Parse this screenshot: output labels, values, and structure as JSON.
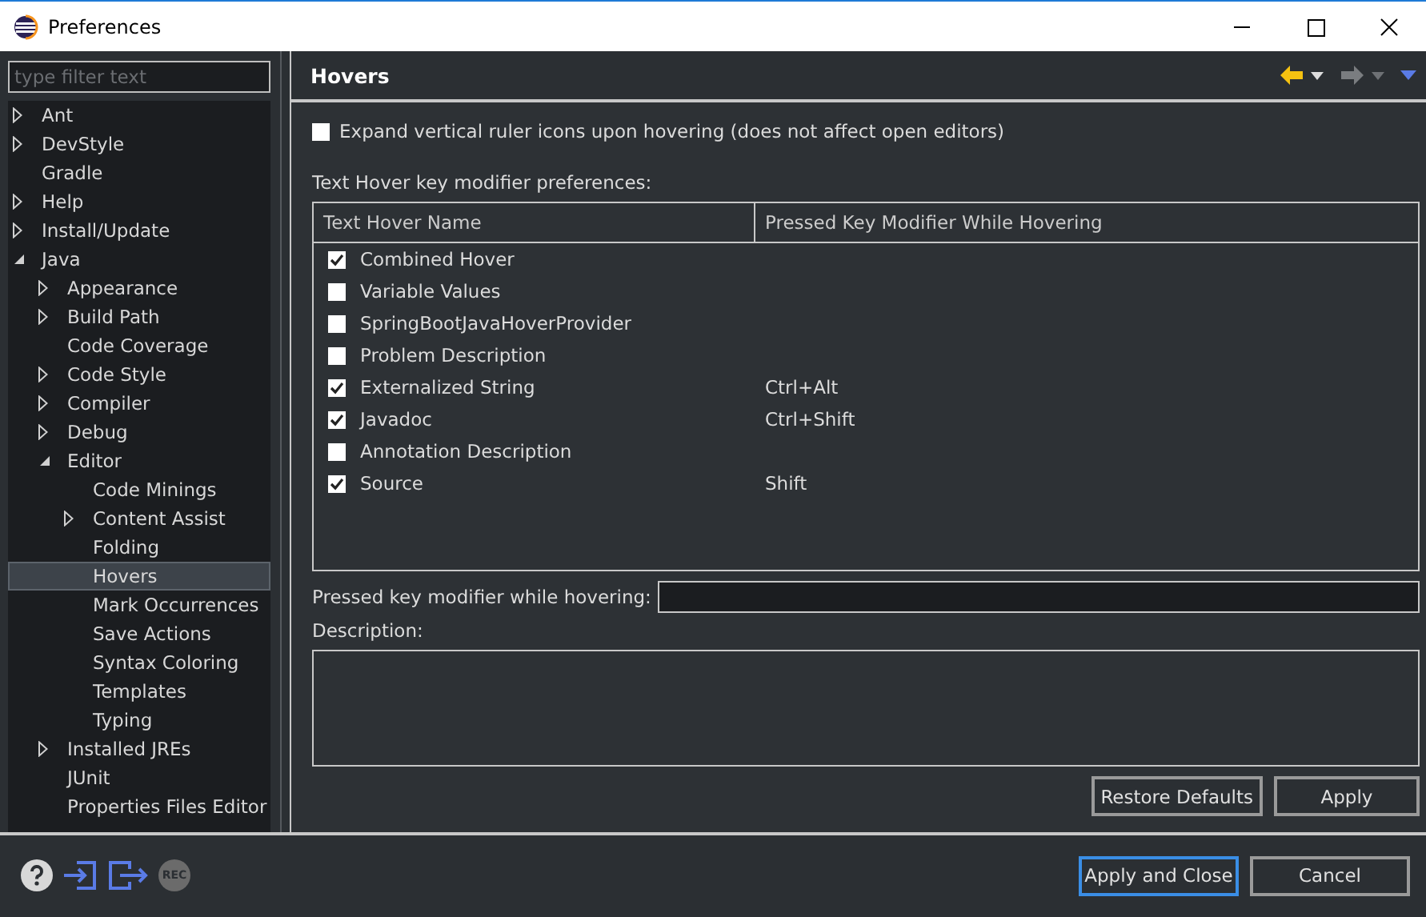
{
  "window": {
    "title": "Preferences"
  },
  "filter": {
    "placeholder": "type filter text"
  },
  "tree": [
    {
      "label": "Ant",
      "expanded": false,
      "selected": false
    },
    {
      "label": "DevStyle",
      "expanded": false,
      "selected": false
    },
    {
      "label": "Gradle",
      "selected": false
    },
    {
      "label": "Help",
      "expanded": false,
      "selected": false
    },
    {
      "label": "Install/Update",
      "expanded": false,
      "selected": false
    },
    {
      "label": "Java",
      "expanded": true,
      "selected": false,
      "children": [
        {
          "label": "Appearance",
          "expanded": false,
          "selected": false
        },
        {
          "label": "Build Path",
          "expanded": false,
          "selected": false
        },
        {
          "label": "Code Coverage",
          "selected": false
        },
        {
          "label": "Code Style",
          "expanded": false,
          "selected": false
        },
        {
          "label": "Compiler",
          "expanded": false,
          "selected": false
        },
        {
          "label": "Debug",
          "expanded": false,
          "selected": false
        },
        {
          "label": "Editor",
          "expanded": true,
          "selected": false,
          "children": [
            {
              "label": "Code Minings",
              "selected": false
            },
            {
              "label": "Content Assist",
              "expanded": false,
              "selected": false
            },
            {
              "label": "Folding",
              "selected": false
            },
            {
              "label": "Hovers",
              "selected": true
            },
            {
              "label": "Mark Occurrences",
              "selected": false
            },
            {
              "label": "Save Actions",
              "selected": false
            },
            {
              "label": "Syntax Coloring",
              "selected": false
            },
            {
              "label": "Templates",
              "selected": false
            },
            {
              "label": "Typing",
              "selected": false
            }
          ]
        },
        {
          "label": "Installed JREs",
          "expanded": false,
          "selected": false
        },
        {
          "label": "JUnit",
          "selected": false
        },
        {
          "label": "Properties Files Editor",
          "selected": false
        }
      ]
    }
  ],
  "page": {
    "title": "Hovers",
    "expand_option": {
      "label": "Expand vertical ruler icons upon hovering (does not affect open editors)",
      "checked": false
    },
    "table_caption": "Text Hover key modifier preferences:",
    "table": {
      "columns": [
        "Text Hover Name",
        "Pressed Key Modifier While Hovering"
      ],
      "rows": [
        {
          "checked": true,
          "name": "Combined Hover",
          "modifier": ""
        },
        {
          "checked": false,
          "name": "Variable Values",
          "modifier": ""
        },
        {
          "checked": false,
          "name": "SpringBootJavaHoverProvider",
          "modifier": ""
        },
        {
          "checked": false,
          "name": "Problem Description",
          "modifier": ""
        },
        {
          "checked": true,
          "name": "Externalized String",
          "modifier": "Ctrl+Alt"
        },
        {
          "checked": true,
          "name": "Javadoc",
          "modifier": "Ctrl+Shift"
        },
        {
          "checked": false,
          "name": "Annotation Description",
          "modifier": ""
        },
        {
          "checked": true,
          "name": "Source",
          "modifier": "Shift"
        }
      ]
    },
    "modifier_field_label": "Pressed key modifier while hovering:",
    "description_label": "Description:",
    "buttons": [
      "Restore Defaults",
      "Apply"
    ]
  },
  "footer": {
    "rec_label": "REC",
    "buttons": [
      {
        "label": "Apply and Close",
        "default": true
      },
      {
        "label": "Cancel",
        "default": false
      }
    ]
  }
}
